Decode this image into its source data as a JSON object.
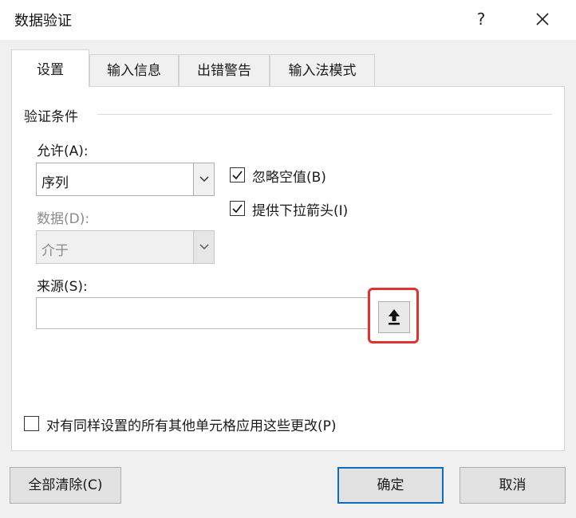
{
  "window": {
    "title": "数据验证",
    "help_label": "?"
  },
  "tabs": [
    {
      "label": "设置",
      "active": true
    },
    {
      "label": "输入信息",
      "active": false
    },
    {
      "label": "出错警告",
      "active": false
    },
    {
      "label": "输入法模式",
      "active": false
    }
  ],
  "validation": {
    "group_label": "验证条件",
    "allow": {
      "label": "允许(A):",
      "value": "序列"
    },
    "data": {
      "label": "数据(D):",
      "value": "介于",
      "disabled": true
    },
    "ignore_blank": {
      "label": "忽略空值(B)",
      "checked": true
    },
    "dropdown_arrow": {
      "label": "提供下拉箭头(I)",
      "checked": true
    },
    "source": {
      "label": "来源(S):",
      "value": ""
    }
  },
  "apply_all": {
    "label": "对有同样设置的所有其他单元格应用这些更改(P)",
    "checked": false
  },
  "buttons": {
    "clear_all": "全部清除(C)",
    "ok": "确定",
    "cancel": "取消"
  },
  "colors": {
    "highlight": "#e23230",
    "primary_border": "#0f6cbd"
  }
}
